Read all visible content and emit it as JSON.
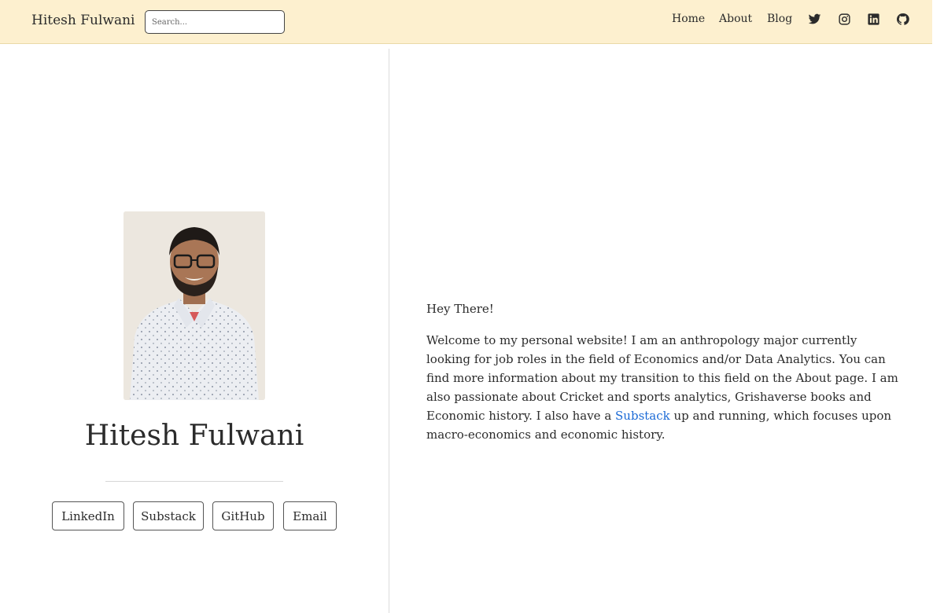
{
  "navbar": {
    "brand": "Hitesh Fulwani",
    "search_placeholder": "Search...",
    "links": [
      {
        "label": "Home"
      },
      {
        "label": "About"
      },
      {
        "label": "Blog"
      }
    ],
    "icons": [
      "twitter-icon",
      "instagram-icon",
      "linkedin-icon",
      "github-icon"
    ],
    "background_color": "#fdf0cf"
  },
  "profile": {
    "name": "Hitesh Fulwani",
    "photo_alt": "portrait photo",
    "buttons": [
      {
        "label": "LinkedIn"
      },
      {
        "label": "Substack"
      },
      {
        "label": "GitHub"
      },
      {
        "label": "Email"
      }
    ]
  },
  "intro": {
    "greeting": "Hey There!",
    "para_before_link": "Welcome to my personal website! I am an anthropology major currently looking for job roles in the field of Economics and/or Data Analytics. You can find more information about my transition to this field on the About page. I am also passionate about Cricket and sports analytics, Grishaverse books and Economic history. I also have a ",
    "link_text": "Substack",
    "para_after_link": " up and running, which focuses upon macro-economics and economic history.",
    "link_color": "#1b6ad6"
  }
}
